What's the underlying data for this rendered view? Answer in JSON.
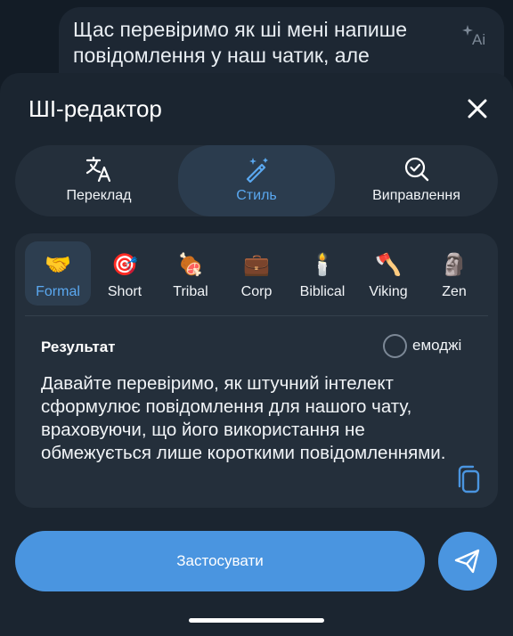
{
  "chat": {
    "message_preview": "Щас перевіримо як ші мені напише повідомлення у наш чатик, але",
    "ai_icon": "sparkle-ai-icon"
  },
  "sheet": {
    "title": "ШІ-редактор",
    "close_icon": "close-icon"
  },
  "modes": [
    {
      "label": "Переклад",
      "icon": "translate-icon",
      "active": false
    },
    {
      "label": "Стиль",
      "icon": "magic-wand-icon",
      "active": true
    },
    {
      "label": "Виправлення",
      "icon": "search-check-icon",
      "active": false
    }
  ],
  "styles": [
    {
      "label": "Formal",
      "emoji": "🤝",
      "active": true
    },
    {
      "label": "Short",
      "emoji": "🎯",
      "active": false
    },
    {
      "label": "Tribal",
      "emoji": "🍖",
      "active": false
    },
    {
      "label": "Corp",
      "emoji": "💼",
      "active": false
    },
    {
      "label": "Biblical",
      "emoji": "🕯️",
      "active": false
    },
    {
      "label": "Viking",
      "emoji": "🪓",
      "active": false
    },
    {
      "label": "Zen",
      "emoji": "🗿",
      "active": false
    }
  ],
  "result": {
    "label": "Результат",
    "emoji_toggle_label": "емоджі",
    "emoji_toggle_checked": false,
    "text": "Давайте перевіримо, як штучний інтелект сформулює повідомлення для нашого чату, враховуючи, що його використання не обмежується лише короткими повідомленнями.",
    "copy_icon": "copy-icon"
  },
  "actions": {
    "apply_label": "Застосувати",
    "send_icon": "send-icon"
  },
  "colors": {
    "accent": "#4a95e0",
    "accent_text": "#5aa8f0",
    "sheet_bg": "#1b2530",
    "panel_bg": "#242f3b"
  }
}
